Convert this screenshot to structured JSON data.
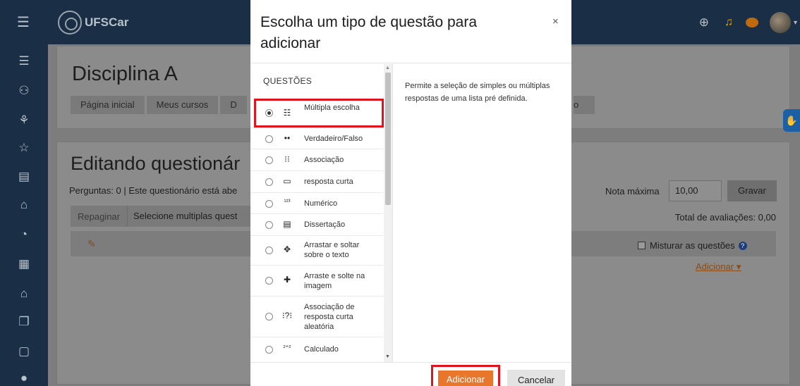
{
  "navbar": {
    "brand": "UFSCar",
    "menu_icon": "hamburger-icon",
    "right_icons": [
      "globe-icon",
      "bell-icon",
      "chat-icon",
      "avatar"
    ]
  },
  "sidebar": {
    "icons": [
      "list-icon",
      "users-icon",
      "badge-icon",
      "star-icon",
      "book-icon",
      "home-icon",
      "dashboard-icon",
      "calendar-icon",
      "graduation-icon",
      "files-icon",
      "clipboard-icon",
      "accessibility-icon"
    ]
  },
  "course": {
    "title": "Disciplina A",
    "breadcrumbs": [
      "Página inicial",
      "Meus cursos",
      "D"
    ],
    "breadcrumb_right": "o"
  },
  "quiz": {
    "title": "Editando questionár",
    "summary": "Perguntas: 0 | Este questionário está abe",
    "repaginate": "Repaginar",
    "select_multiple": "Selecione multiplas quest",
    "max_grade_label": "Nota máxima",
    "max_grade_value": "10,00",
    "save_label": "Gravar",
    "total": "Total de avaliações: 0,00",
    "shuffle_label": "Misturar as questões",
    "add_link": "Adicionar"
  },
  "modal": {
    "title": "Escolha um tipo de questão para adicionar",
    "close_symbol": "×",
    "section_header": "QUESTÕES",
    "description": "Permite a seleção de simples ou múltiplas respostas de uma lista pré definida.",
    "add_button": "Adicionar",
    "cancel_button": "Cancelar",
    "question_types": [
      {
        "label": "Múltipla escolha",
        "icon": "☷",
        "selected": true
      },
      {
        "label": "Verdadeiro/Falso",
        "icon": "••",
        "selected": false
      },
      {
        "label": "Associação",
        "icon": "⁝⁝",
        "selected": false
      },
      {
        "label": "resposta curta",
        "icon": "▭",
        "selected": false
      },
      {
        "label": "Numérico",
        "icon": "¹²³",
        "selected": false
      },
      {
        "label": "Dissertação",
        "icon": "▤",
        "selected": false
      },
      {
        "label": "Arrastar e soltar sobre o texto",
        "icon": "✥",
        "selected": false
      },
      {
        "label": "Arraste e solte na imagem",
        "icon": "✚",
        "selected": false
      },
      {
        "label": "Associação de resposta curta aleatória",
        "icon": "⁝?⁝",
        "selected": false
      },
      {
        "label": "Calculado",
        "icon": "²⁺²",
        "selected": false
      }
    ]
  }
}
